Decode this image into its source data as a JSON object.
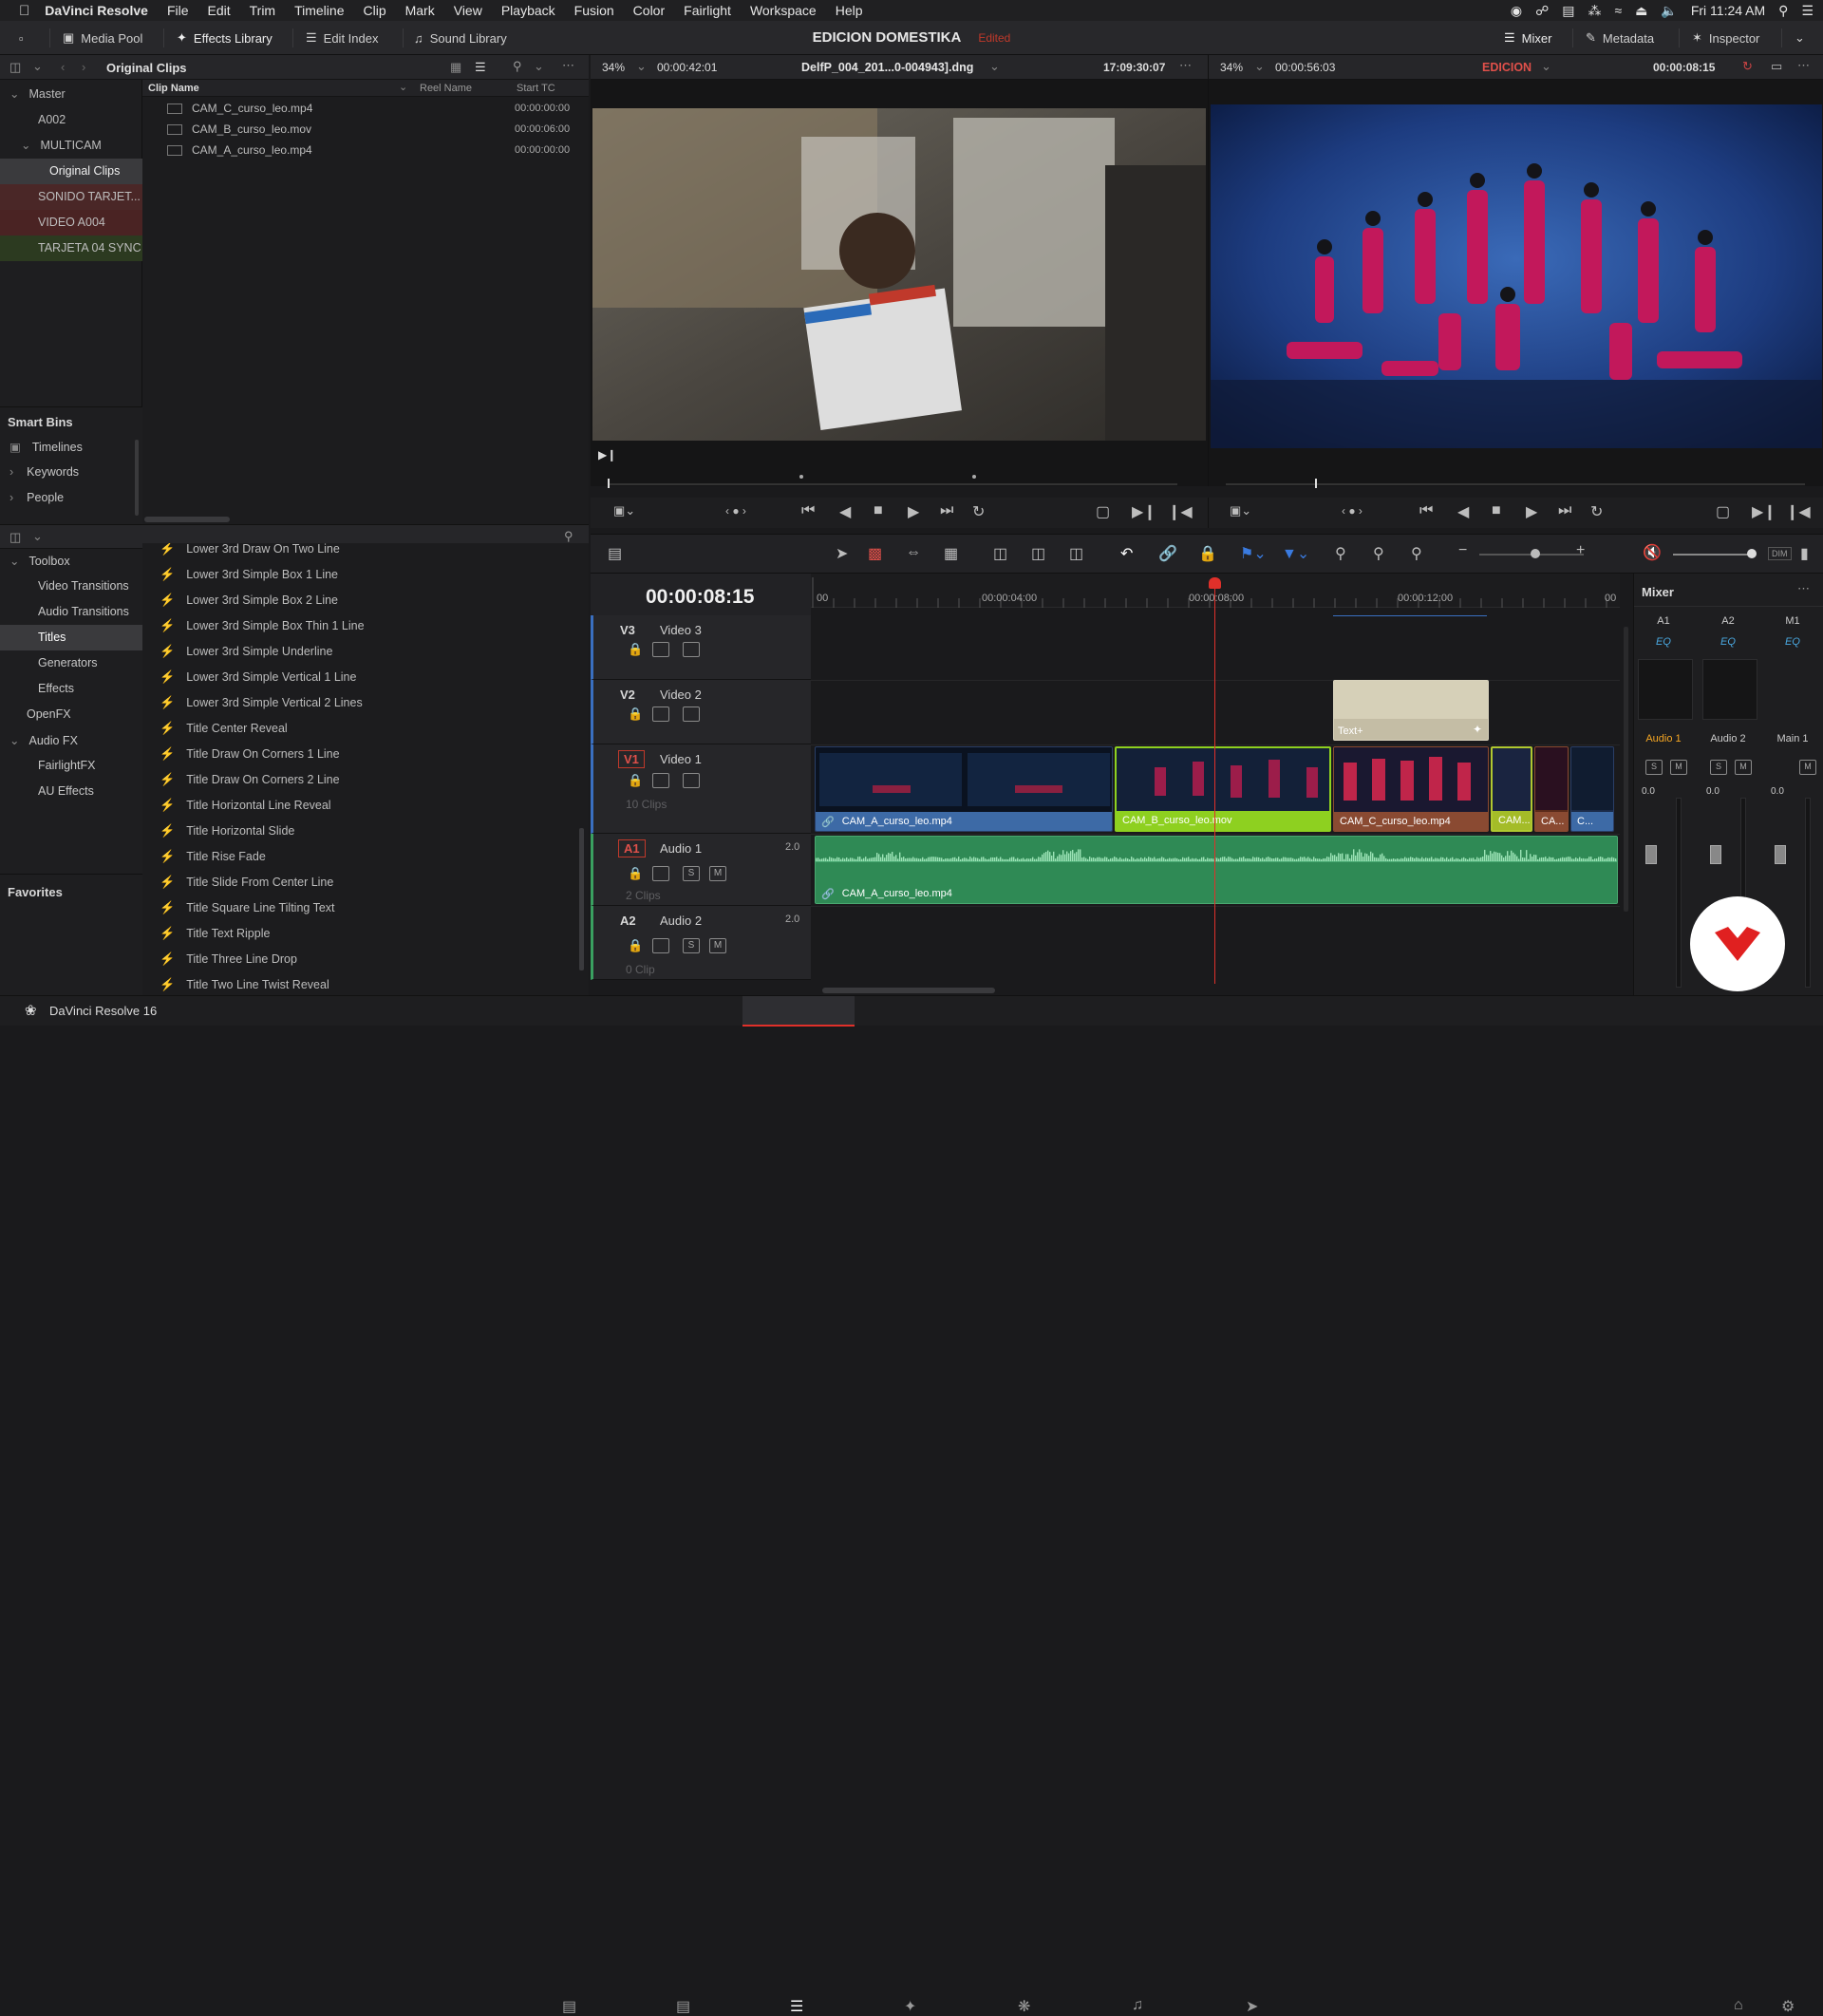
{
  "menubar": {
    "app": "DaVinci Resolve",
    "items": [
      "File",
      "Edit",
      "Trim",
      "Timeline",
      "Clip",
      "Mark",
      "View",
      "Playback",
      "Fusion",
      "Color",
      "Fairlight",
      "Workspace",
      "Help"
    ],
    "clock": "Fri 11:24 AM"
  },
  "toolbar": {
    "media_pool": "Media Pool",
    "effects_library": "Effects Library",
    "edit_index": "Edit Index",
    "sound_library": "Sound Library",
    "project": "EDICION DOMESTIKA",
    "edited": "Edited",
    "mixer": "Mixer",
    "metadata": "Metadata",
    "inspector": "Inspector"
  },
  "bins": {
    "header": "Original Clips",
    "master": "Master",
    "a002": "A002",
    "multicam": "MULTICAM",
    "original": "Original Clips",
    "sonido": "SONIDO TARJET...",
    "video": "VIDEO A004",
    "tarjeta": "TARJETA 04 SYNC",
    "colors": {
      "sonido": "#5b2a2a",
      "video": "#5a2424",
      "tarjeta": "#2f4020"
    }
  },
  "smart_bins": {
    "title": "Smart Bins",
    "timelines": "Timelines",
    "keywords": "Keywords",
    "people": "People"
  },
  "clips": {
    "col_name": "Clip Name",
    "col_reel": "Reel Name",
    "col_tc": "Start TC",
    "rows": [
      {
        "name": "CAM_C_curso_leo.mp4",
        "tc": "00:00:00:00"
      },
      {
        "name": "CAM_B_curso_leo.mov",
        "tc": "00:00:06:00"
      },
      {
        "name": "CAM_A_curso_leo.mp4",
        "tc": "00:00:00:00"
      }
    ]
  },
  "source": {
    "zoom": "34%",
    "tc": "00:00:42:01",
    "filename": "DelfP_004_201...0-004943].dng",
    "clock": "17:09:30:07"
  },
  "program": {
    "zoom": "34%",
    "tc": "00:00:56:03",
    "timeline": "EDICION",
    "time": "00:00:08:15"
  },
  "toolbox": {
    "toolbox": "Toolbox",
    "video_transitions": "Video Transitions",
    "audio_transitions": "Audio Transitions",
    "titles": "Titles",
    "generators": "Generators",
    "effects": "Effects",
    "openfx": "OpenFX",
    "audiofx": "Audio FX",
    "fairlightfx": "FairlightFX",
    "aueffects": "AU Effects",
    "favorites": "Favorites"
  },
  "titles_list": [
    "Lower 3rd Draw On Two Line",
    "Lower 3rd Simple Box 1 Line",
    "Lower 3rd Simple Box 2 Line",
    "Lower 3rd Simple Box Thin 1 Line",
    "Lower 3rd Simple Underline",
    "Lower 3rd Simple Vertical 1 Line",
    "Lower 3rd Simple Vertical 2 Lines",
    "Title Center Reveal",
    "Title Draw On Corners 1 Line",
    "Title Draw On Corners 2 Line",
    "Title Horizontal Line Reveal",
    "Title Horizontal Slide",
    "Title Rise Fade",
    "Title Slide From Center Line",
    "Title Square Line Tilting Text",
    "Title Text Ripple",
    "Title Three Line Drop",
    "Title Two Line Twist Reveal"
  ],
  "timeline": {
    "timecode": "00:00:08:15",
    "ruler": [
      "00",
      "00:00:04:00",
      "00:00:08:00",
      "00:00:12:00",
      "00"
    ],
    "tracks": {
      "v3": {
        "id": "V3",
        "name": "Video 3"
      },
      "v2": {
        "id": "V2",
        "name": "Video 2"
      },
      "v1": {
        "id": "V1",
        "name": "Video 1",
        "count": "10 Clips"
      },
      "a1": {
        "id": "A1",
        "name": "Audio 1",
        "ch": "2.0",
        "count": "2 Clips"
      },
      "a2": {
        "id": "A2",
        "name": "Audio 2",
        "ch": "2.0",
        "count": "0 Clip"
      }
    },
    "clips": {
      "a": "CAM_A_curso_leo.mp4",
      "b": "CAM_B_curso_leo.mov",
      "c": "CAM_C_curso_leo.mp4",
      "s1": "CAM...",
      "s2": "CA...",
      "s3": "C...",
      "text": "Text+",
      "audio": "CAM_A_curso_leo.mp4"
    },
    "s": "S",
    "m": "M"
  },
  "mixer": {
    "title": "Mixer",
    "a1": "A1",
    "a2": "A2",
    "m1": "M1",
    "eq": "EQ",
    "audio1": "Audio 1",
    "audio2": "Audio 2",
    "main1": "Main 1",
    "zero": "0.0"
  },
  "status": {
    "app": "DaVinci Resolve 16"
  }
}
